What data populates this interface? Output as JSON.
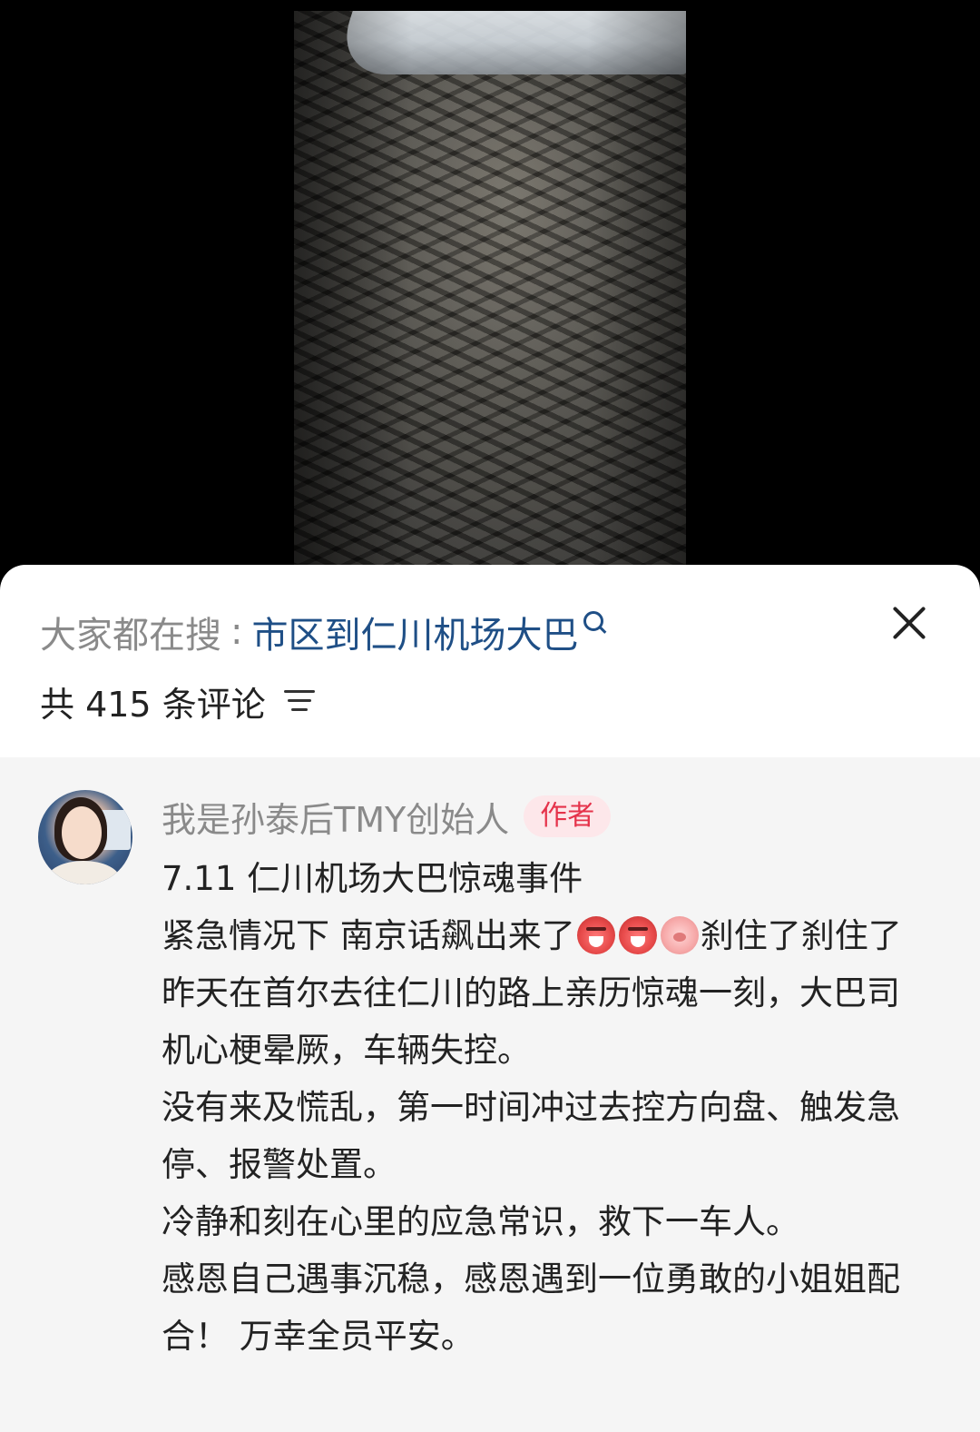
{
  "search": {
    "prefix": "大家都在搜",
    "separator": ":",
    "term": "市区到仁川机场大巴"
  },
  "comments_header": {
    "count_label": "共 415 条评论"
  },
  "comment": {
    "author": "我是孙泰后TMY创始人",
    "badge": "作者",
    "title": "7.11 仁川机场大巴惊魂事件",
    "line2_before": "紧急情况下 南京话飙出来了",
    "line2_after": "刹住了刹住了",
    "paragraph1": "昨天在首尔去往仁川的路上亲历惊魂一刻，大巴司机心梗晕厥，车辆失控。",
    "paragraph2": "没有来及慌乱，第一时间冲过去控方向盘、触发急停、报警处置。",
    "paragraph3": "冷静和刻在心里的应急常识，救下一车人。",
    "paragraph4": "感恩自己遇事沉稳，感恩遇到一位勇敢的小姐姐配合！ 万幸全员平安。"
  },
  "icons": {
    "search": "search-icon",
    "close": "close-icon",
    "sort": "sort-icon",
    "emoji1": "scream-emoji",
    "emoji2": "scream-emoji",
    "emoji3": "pig-emoji"
  },
  "colors": {
    "link_blue": "#1f4f86",
    "badge_red": "#e5334b",
    "badge_bg": "#fde7ea",
    "comment_bg": "#f5f5f5"
  }
}
